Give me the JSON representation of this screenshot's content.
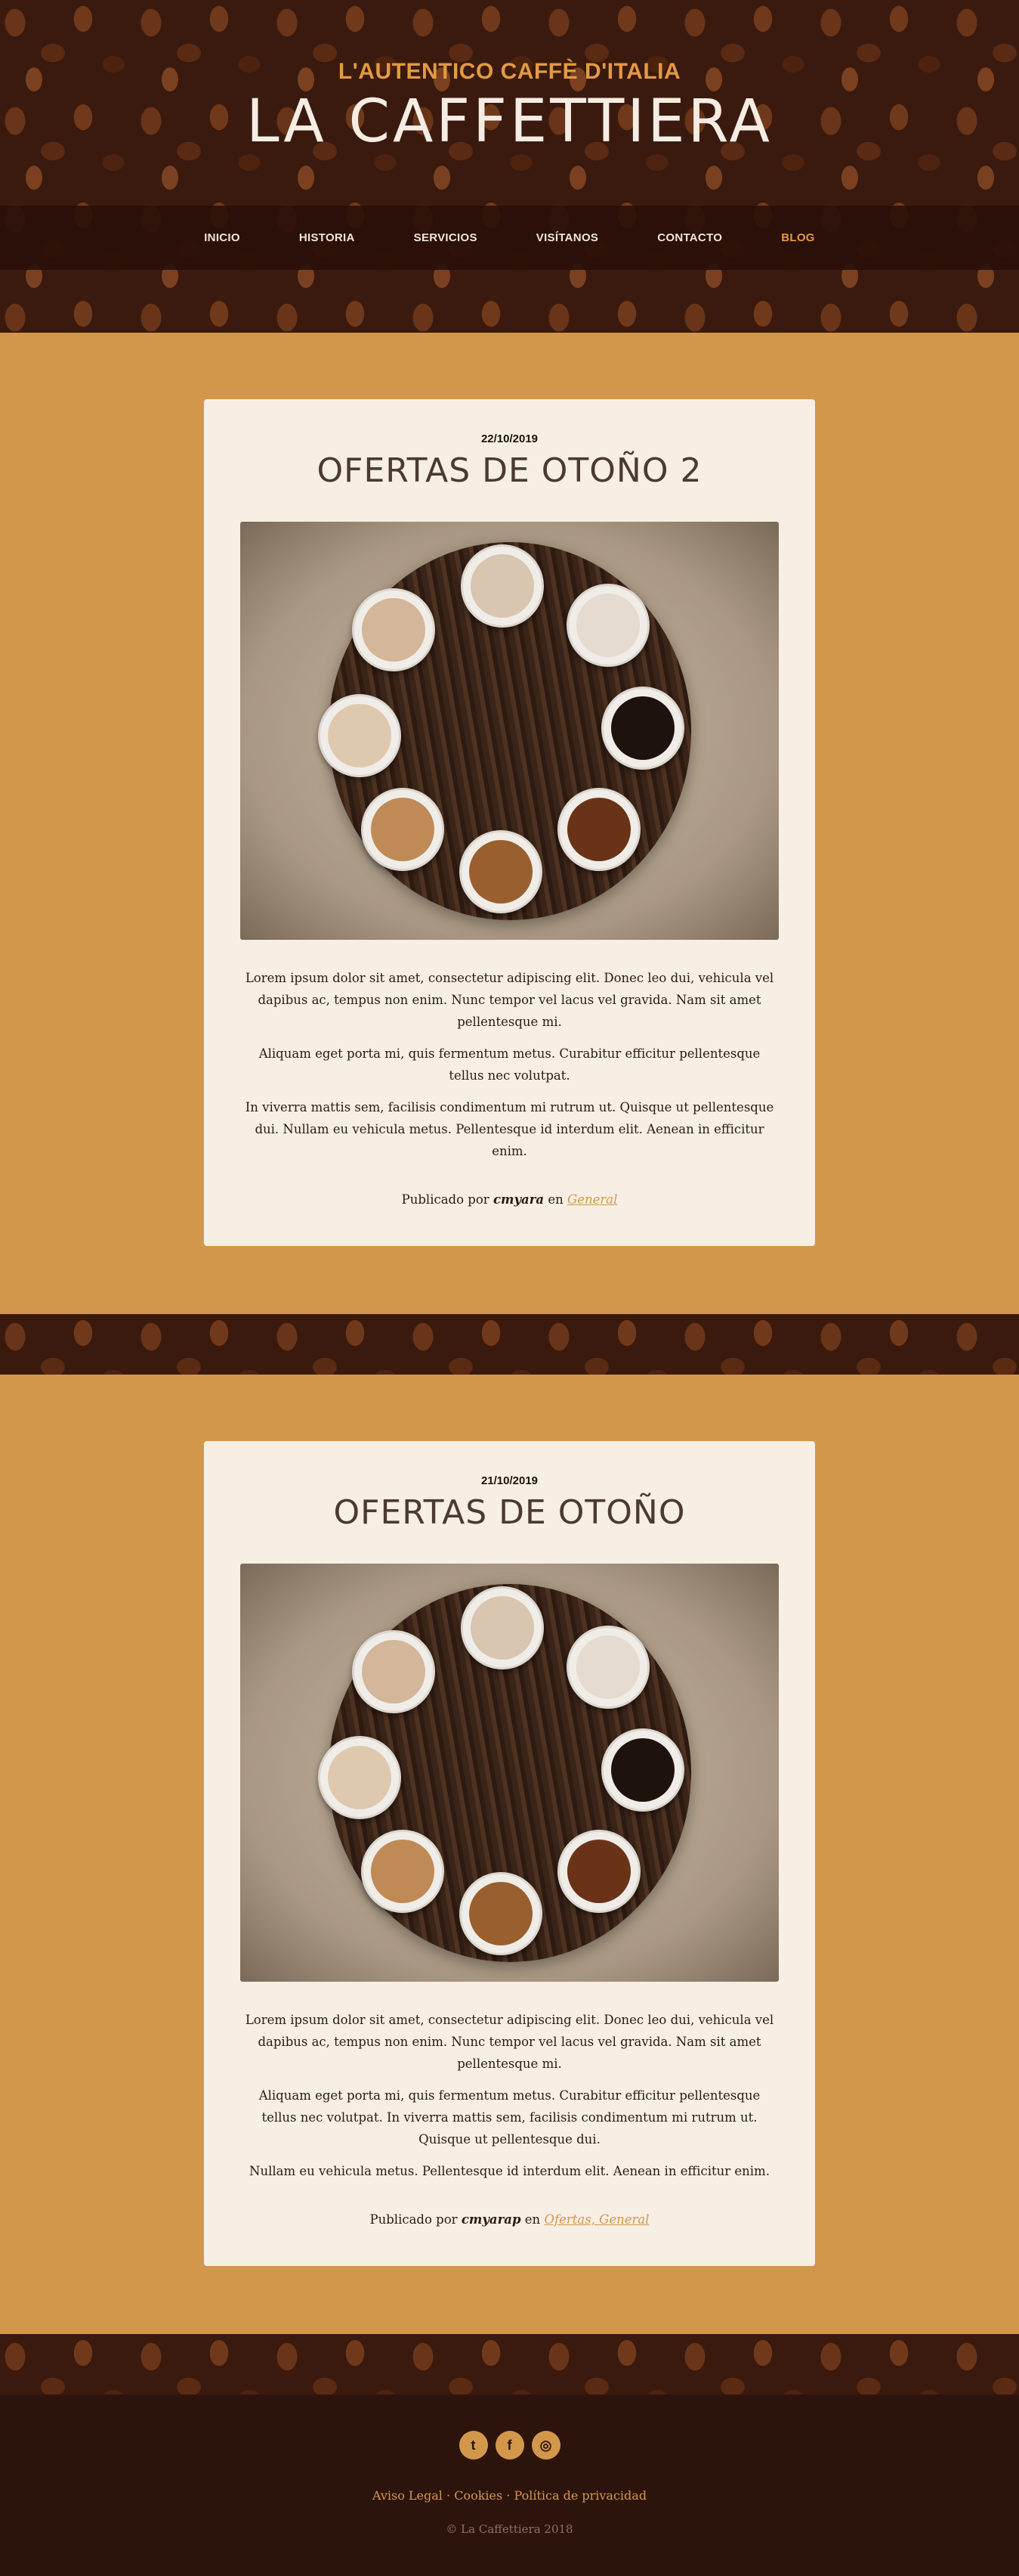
{
  "header": {
    "tagline": "L'AUTENTICO CAFFÈ D'ITALIA",
    "title": "LA CAFFETTIERA"
  },
  "nav": {
    "items": [
      {
        "label": "INICIO"
      },
      {
        "label": "HISTORIA"
      },
      {
        "label": "SERVICIOS"
      },
      {
        "label": "VISÍTANOS"
      },
      {
        "label": "CONTACTO"
      },
      {
        "label": "BLOG",
        "active": true
      }
    ]
  },
  "posts": [
    {
      "date": "22/10/2019",
      "title": "OFERTAS DE OTOÑO 2",
      "paragraphs": [
        "Lorem ipsum dolor sit amet, consectetur adipiscing elit. Donec leo dui, vehicula vel dapibus ac, tempus non enim. Nunc tempor vel lacus vel gravida. Nam sit amet pellentesque mi.",
        "Aliquam eget porta mi, quis fermentum metus. Curabitur efficitur pellentesque tellus nec volutpat.",
        "In viverra mattis sem, facilisis condimentum mi rutrum ut. Quisque ut pellentesque dui. Nullam eu vehicula metus. Pellentesque id interdum elit. Aenean in efficitur enim."
      ],
      "meta_prefix": "Publicado por",
      "author": "cmyara",
      "meta_in": "en",
      "categories": "General"
    },
    {
      "date": "21/10/2019",
      "title": "OFERTAS DE OTOÑO",
      "paragraphs": [
        "Lorem ipsum dolor sit amet, consectetur adipiscing elit. Donec leo dui, vehicula vel dapibus ac, tempus non enim. Nunc tempor vel lacus vel gravida. Nam sit amet pellentesque mi.",
        "Aliquam eget porta mi, quis fermentum metus. Curabitur efficitur pellentesque tellus nec volutpat. In viverra mattis sem, facilisis condimentum mi rutrum ut. Quisque ut pellentesque dui.",
        "Nullam eu vehicula metus. Pellentesque id interdum elit. Aenean in efficitur enim."
      ],
      "meta_prefix": "Publicado por",
      "author": "cmyarap",
      "meta_in": "en",
      "categories": "Ofertas, General"
    }
  ],
  "footer": {
    "social": [
      {
        "icon": "twitter-icon",
        "glyph": "t"
      },
      {
        "icon": "facebook-icon",
        "glyph": "f"
      },
      {
        "icon": "instagram-icon",
        "glyph": "◎"
      }
    ],
    "links": {
      "legal": "Aviso Legal",
      "sep1": " · ",
      "cookies": "Cookies",
      "sep2": " · ",
      "privacy": "Política de privacidad"
    },
    "copyright": "© La Caffettiera 2018"
  },
  "colors": {
    "accent": "#d3974c",
    "dark": "#2c140d",
    "card": "#f7efe4"
  }
}
